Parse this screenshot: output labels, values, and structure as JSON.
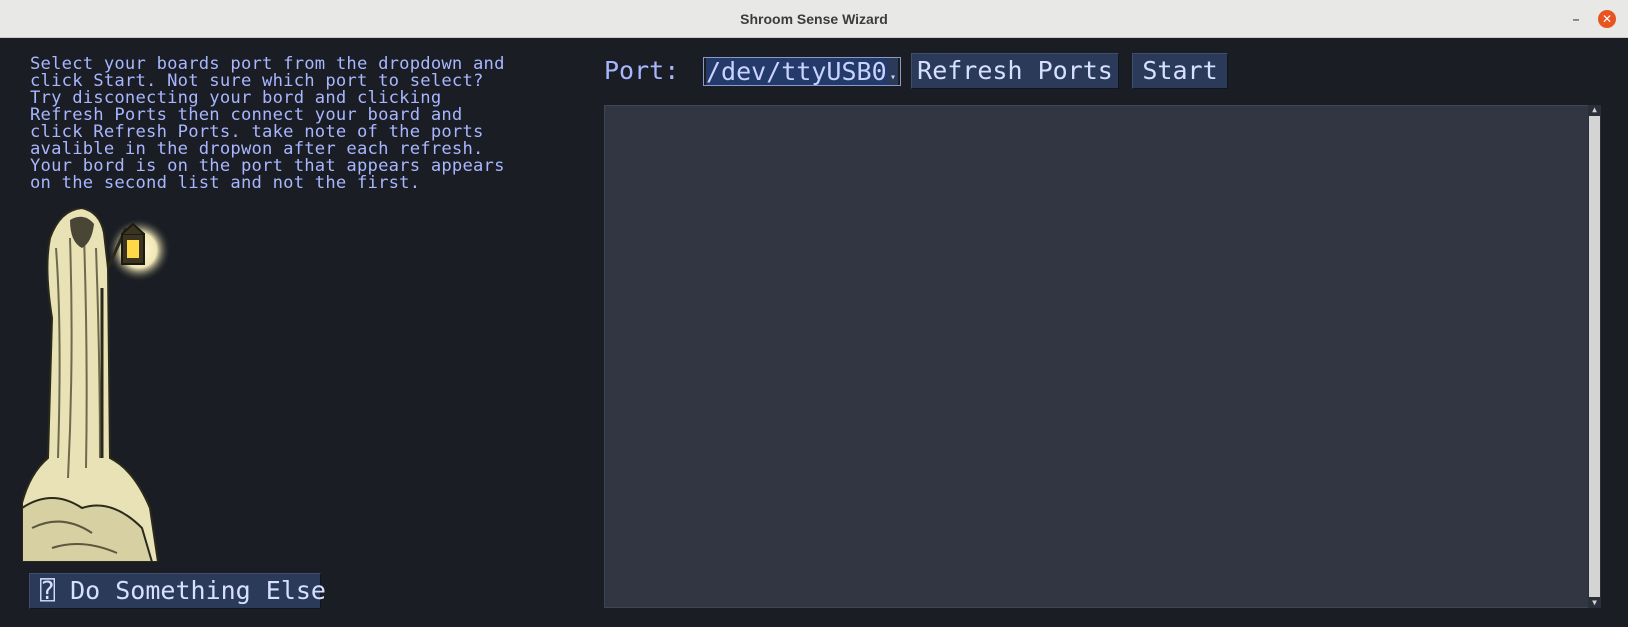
{
  "window": {
    "title": "Shroom Sense Wizard",
    "minimize_glyph": "–",
    "close_glyph": "✕"
  },
  "instructions": "Select your boards port from the dropdown and\nclick Start. Not sure which port to select?\nTry disconecting your bord and clicking\nRefresh Ports then connect your board and\nclick Refresh Ports. take note of the ports\navalible in the dropwon after each refresh.\nYour bord is on the port that appears appears\non the second list and not the first.",
  "buttons": {
    "do_something_else": "⍰ Do Something Else",
    "refresh_ports": "Refresh Ports",
    "start": "Start"
  },
  "port": {
    "label": "Port:",
    "selected": "/dev/ttyUSB0"
  },
  "icons": {
    "wizard_image": "wizard-with-lantern",
    "dropdown": "chevron-down-icon"
  },
  "colors": {
    "text_accent": "#a8b6ff",
    "button_bg": "#2a3a58",
    "background": "#1a1d23",
    "output_bg": "#323642"
  }
}
